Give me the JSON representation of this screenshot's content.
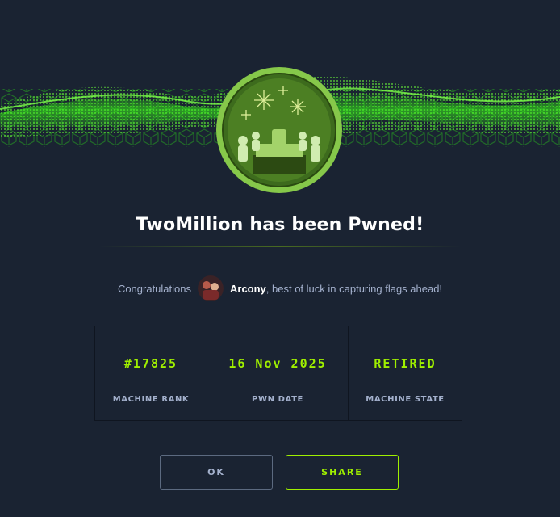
{
  "dialog": {
    "title": "TwoMillion has been Pwned!",
    "congrats_prefix": "Congratulations",
    "username": "Arcony",
    "congrats_suffix": ", best of luck in capturing flags ahead!"
  },
  "stats": [
    {
      "value": "#17825",
      "label": "MACHINE RANK"
    },
    {
      "value": "16 Nov 2025",
      "label": "PWN DATE"
    },
    {
      "value": "RETIRED",
      "label": "MACHINE STATE"
    }
  ],
  "buttons": {
    "ok_label": "OK",
    "share_label": "SHARE"
  },
  "colors": {
    "background": "#1a2332",
    "accent": "#9fef00",
    "muted_text": "#a4b1cd"
  }
}
